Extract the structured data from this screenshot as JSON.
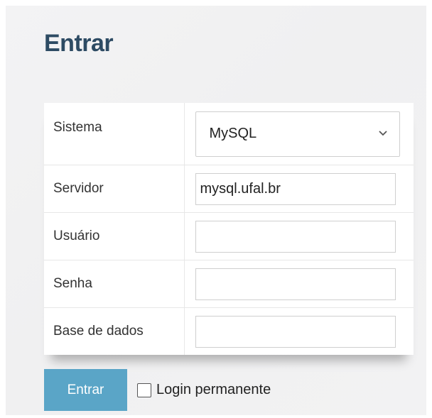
{
  "login": {
    "title": "Entrar",
    "fields": {
      "system": {
        "label": "Sistema",
        "selected": "MySQL"
      },
      "server": {
        "label": "Servidor",
        "value": "mysql.ufal.br",
        "placeholder": ""
      },
      "username": {
        "label": "Usuário",
        "value": "",
        "placeholder": ""
      },
      "password": {
        "label": "Senha",
        "value": "",
        "placeholder": ""
      },
      "database": {
        "label": "Base de dados",
        "value": "",
        "placeholder": ""
      }
    },
    "submit_label": "Entrar",
    "permanent_login_label": "Login permanente",
    "permanent_login_checked": false
  },
  "colors": {
    "title": "#2d4b63",
    "button": "#5aa5c7",
    "panel_background": "#f2f2f3"
  },
  "icons": {
    "select_arrow": "chevron-down-icon"
  }
}
